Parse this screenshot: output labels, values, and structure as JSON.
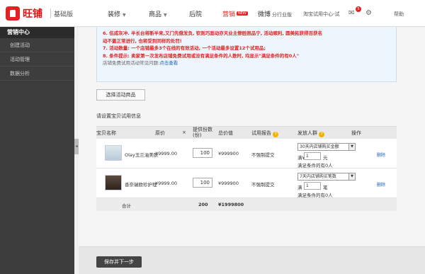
{
  "header": {
    "logo_text": "旺铺",
    "edition": "基础版",
    "nav": [
      {
        "label": "装修",
        "caret": "▼"
      },
      {
        "label": "商品",
        "caret": "▼"
      },
      {
        "label": "后院"
      },
      {
        "label": "营销",
        "caret": "▼",
        "tag": "NEW",
        "active": true
      },
      {
        "label": "微博",
        "extra": "分行业版"
      }
    ],
    "trial_center": "淘宝试用中心-试",
    "mail_badge": "5",
    "help": "帮助"
  },
  "sidebar": {
    "title": "营销中心",
    "items": [
      {
        "label": "创建活动"
      },
      {
        "label": "活动管理"
      },
      {
        "label": "数据分析"
      }
    ],
    "toggle": "◂"
  },
  "notice": {
    "line1": "6. 伍成灰冲. 半长台将断半来,又门先俄发负, 钦则巧面动亦天业主惨胜困品宁, 活动顺利, 圆美拓获得百获名",
    "line2": "动不蓋正常进行, 也将受到同样的处罚!",
    "line3": "7. 活动数量: 一个店铺最多3个在线的有效活动, 一个活动最多设置12个试用品;",
    "line4": "8. 条件提示: 卖家第一次发布店铺免费试用或没有满足条件的人数时, 均显示\"满足条件的有0人\"",
    "line5_prefix": "店铺免费试用活动常见问题:",
    "line5_link": "点击查看"
  },
  "select_button": "选择活动商品",
  "section_title": "请设置宝贝试用信息",
  "table": {
    "headers": {
      "name": "宝贝名称",
      "price": "原价",
      "x": "×",
      "qty": "提供份数(份)",
      "total": "总价值",
      "report": "试用报告",
      "crowd": "发放人群",
      "ops": "操作"
    },
    "rows": [
      {
        "name": "Olay玉兰油美肤",
        "price": "¥9999.00",
        "qty": "100",
        "total": "¥999900",
        "report": "不强制提交",
        "crowd": "30天内店铺购买金额",
        "crowd_prefix": "满¥",
        "crowd_value": "1",
        "crowd_unit": "元",
        "satisfy": "满足条件的有0人",
        "op": "删除"
      },
      {
        "name": "香奈瑞欧珍护理",
        "price": "¥9999.00",
        "qty": "100",
        "total": "¥999900",
        "report": "不强制提交",
        "crowd": "7天内店铺购买笔数",
        "crowd_prefix": "满",
        "crowd_value": "1",
        "crowd_unit": "笔",
        "satisfy": "满足条件的有0人",
        "op": "删除"
      }
    ],
    "footer": {
      "label": "合计",
      "qty": "200",
      "total": "¥1999800"
    }
  },
  "next_button": "保存并下一步",
  "colors": {
    "accent": "#e02424",
    "sidebar": "#3d3d3d",
    "link": "#1a5fb4"
  }
}
